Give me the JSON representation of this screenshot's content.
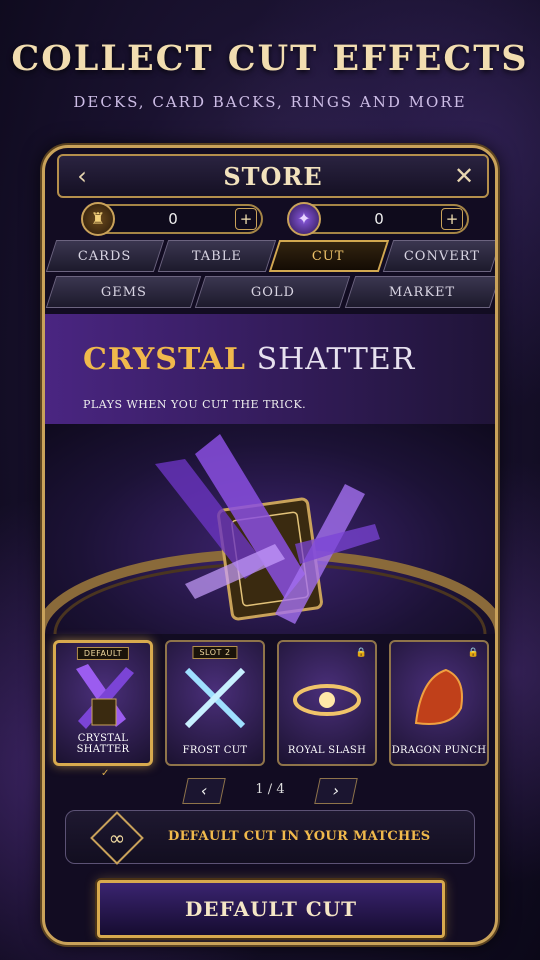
{
  "headline": "COLLECT CUT EFFECTS",
  "subline": "DECKS, CARD BACKS, RINGS AND MORE",
  "store": {
    "title": "STORE",
    "currency_1": {
      "value": "0",
      "icon": "gold-coin-icon"
    },
    "currency_2": {
      "value": "0",
      "icon": "purple-gem-icon"
    }
  },
  "tabs_row1": [
    "CARDS",
    "TABLE",
    "CUT",
    "CONVERT"
  ],
  "tabs_row2": [
    "GEMS",
    "GOLD",
    "MARKET"
  ],
  "active_tab": "CUT",
  "hero": {
    "name_bold": "CRYSTAL",
    "name_rest": "SHATTER",
    "description": "PLAYS WHEN YOU CUT THE TRICK."
  },
  "thumbs": [
    {
      "label": "CRYSTAL SHATTER",
      "badge": "DEFAULT",
      "locked": false,
      "selected": true
    },
    {
      "label": "FROST CUT",
      "badge": "SLOT 2",
      "locked": false,
      "selected": false
    },
    {
      "label": "ROYAL SLASH",
      "badge": "",
      "locked": true,
      "selected": false
    },
    {
      "label": "DRAGON PUNCH",
      "badge": "",
      "locked": true,
      "selected": false
    }
  ],
  "pager": {
    "text": "1 / 4"
  },
  "info_text": "DEFAULT CUT IN YOUR MATCHES",
  "cta_label": "DEFAULT CUT",
  "colors": {
    "gold": "#d8aa4e",
    "accent": "#f0b94c",
    "purple": "#3a2470"
  }
}
